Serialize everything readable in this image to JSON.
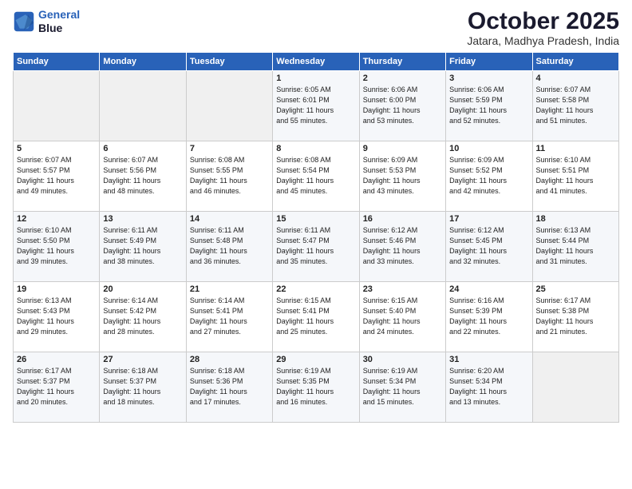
{
  "header": {
    "logo_line1": "General",
    "logo_line2": "Blue",
    "month": "October 2025",
    "location": "Jatara, Madhya Pradesh, India"
  },
  "weekdays": [
    "Sunday",
    "Monday",
    "Tuesday",
    "Wednesday",
    "Thursday",
    "Friday",
    "Saturday"
  ],
  "weeks": [
    [
      {
        "day": "",
        "sunrise": "",
        "sunset": "",
        "daylight": ""
      },
      {
        "day": "",
        "sunrise": "",
        "sunset": "",
        "daylight": ""
      },
      {
        "day": "",
        "sunrise": "",
        "sunset": "",
        "daylight": ""
      },
      {
        "day": "1",
        "sunrise": "Sunrise: 6:05 AM",
        "sunset": "Sunset: 6:01 PM",
        "daylight": "Daylight: 11 hours and 55 minutes."
      },
      {
        "day": "2",
        "sunrise": "Sunrise: 6:06 AM",
        "sunset": "Sunset: 6:00 PM",
        "daylight": "Daylight: 11 hours and 53 minutes."
      },
      {
        "day": "3",
        "sunrise": "Sunrise: 6:06 AM",
        "sunset": "Sunset: 5:59 PM",
        "daylight": "Daylight: 11 hours and 52 minutes."
      },
      {
        "day": "4",
        "sunrise": "Sunrise: 6:07 AM",
        "sunset": "Sunset: 5:58 PM",
        "daylight": "Daylight: 11 hours and 51 minutes."
      }
    ],
    [
      {
        "day": "5",
        "sunrise": "Sunrise: 6:07 AM",
        "sunset": "Sunset: 5:57 PM",
        "daylight": "Daylight: 11 hours and 49 minutes."
      },
      {
        "day": "6",
        "sunrise": "Sunrise: 6:07 AM",
        "sunset": "Sunset: 5:56 PM",
        "daylight": "Daylight: 11 hours and 48 minutes."
      },
      {
        "day": "7",
        "sunrise": "Sunrise: 6:08 AM",
        "sunset": "Sunset: 5:55 PM",
        "daylight": "Daylight: 11 hours and 46 minutes."
      },
      {
        "day": "8",
        "sunrise": "Sunrise: 6:08 AM",
        "sunset": "Sunset: 5:54 PM",
        "daylight": "Daylight: 11 hours and 45 minutes."
      },
      {
        "day": "9",
        "sunrise": "Sunrise: 6:09 AM",
        "sunset": "Sunset: 5:53 PM",
        "daylight": "Daylight: 11 hours and 43 minutes."
      },
      {
        "day": "10",
        "sunrise": "Sunrise: 6:09 AM",
        "sunset": "Sunset: 5:52 PM",
        "daylight": "Daylight: 11 hours and 42 minutes."
      },
      {
        "day": "11",
        "sunrise": "Sunrise: 6:10 AM",
        "sunset": "Sunset: 5:51 PM",
        "daylight": "Daylight: 11 hours and 41 minutes."
      }
    ],
    [
      {
        "day": "12",
        "sunrise": "Sunrise: 6:10 AM",
        "sunset": "Sunset: 5:50 PM",
        "daylight": "Daylight: 11 hours and 39 minutes."
      },
      {
        "day": "13",
        "sunrise": "Sunrise: 6:11 AM",
        "sunset": "Sunset: 5:49 PM",
        "daylight": "Daylight: 11 hours and 38 minutes."
      },
      {
        "day": "14",
        "sunrise": "Sunrise: 6:11 AM",
        "sunset": "Sunset: 5:48 PM",
        "daylight": "Daylight: 11 hours and 36 minutes."
      },
      {
        "day": "15",
        "sunrise": "Sunrise: 6:11 AM",
        "sunset": "Sunset: 5:47 PM",
        "daylight": "Daylight: 11 hours and 35 minutes."
      },
      {
        "day": "16",
        "sunrise": "Sunrise: 6:12 AM",
        "sunset": "Sunset: 5:46 PM",
        "daylight": "Daylight: 11 hours and 33 minutes."
      },
      {
        "day": "17",
        "sunrise": "Sunrise: 6:12 AM",
        "sunset": "Sunset: 5:45 PM",
        "daylight": "Daylight: 11 hours and 32 minutes."
      },
      {
        "day": "18",
        "sunrise": "Sunrise: 6:13 AM",
        "sunset": "Sunset: 5:44 PM",
        "daylight": "Daylight: 11 hours and 31 minutes."
      }
    ],
    [
      {
        "day": "19",
        "sunrise": "Sunrise: 6:13 AM",
        "sunset": "Sunset: 5:43 PM",
        "daylight": "Daylight: 11 hours and 29 minutes."
      },
      {
        "day": "20",
        "sunrise": "Sunrise: 6:14 AM",
        "sunset": "Sunset: 5:42 PM",
        "daylight": "Daylight: 11 hours and 28 minutes."
      },
      {
        "day": "21",
        "sunrise": "Sunrise: 6:14 AM",
        "sunset": "Sunset: 5:41 PM",
        "daylight": "Daylight: 11 hours and 27 minutes."
      },
      {
        "day": "22",
        "sunrise": "Sunrise: 6:15 AM",
        "sunset": "Sunset: 5:41 PM",
        "daylight": "Daylight: 11 hours and 25 minutes."
      },
      {
        "day": "23",
        "sunrise": "Sunrise: 6:15 AM",
        "sunset": "Sunset: 5:40 PM",
        "daylight": "Daylight: 11 hours and 24 minutes."
      },
      {
        "day": "24",
        "sunrise": "Sunrise: 6:16 AM",
        "sunset": "Sunset: 5:39 PM",
        "daylight": "Daylight: 11 hours and 22 minutes."
      },
      {
        "day": "25",
        "sunrise": "Sunrise: 6:17 AM",
        "sunset": "Sunset: 5:38 PM",
        "daylight": "Daylight: 11 hours and 21 minutes."
      }
    ],
    [
      {
        "day": "26",
        "sunrise": "Sunrise: 6:17 AM",
        "sunset": "Sunset: 5:37 PM",
        "daylight": "Daylight: 11 hours and 20 minutes."
      },
      {
        "day": "27",
        "sunrise": "Sunrise: 6:18 AM",
        "sunset": "Sunset: 5:37 PM",
        "daylight": "Daylight: 11 hours and 18 minutes."
      },
      {
        "day": "28",
        "sunrise": "Sunrise: 6:18 AM",
        "sunset": "Sunset: 5:36 PM",
        "daylight": "Daylight: 11 hours and 17 minutes."
      },
      {
        "day": "29",
        "sunrise": "Sunrise: 6:19 AM",
        "sunset": "Sunset: 5:35 PM",
        "daylight": "Daylight: 11 hours and 16 minutes."
      },
      {
        "day": "30",
        "sunrise": "Sunrise: 6:19 AM",
        "sunset": "Sunset: 5:34 PM",
        "daylight": "Daylight: 11 hours and 15 minutes."
      },
      {
        "day": "31",
        "sunrise": "Sunrise: 6:20 AM",
        "sunset": "Sunset: 5:34 PM",
        "daylight": "Daylight: 11 hours and 13 minutes."
      },
      {
        "day": "",
        "sunrise": "",
        "sunset": "",
        "daylight": ""
      }
    ]
  ]
}
